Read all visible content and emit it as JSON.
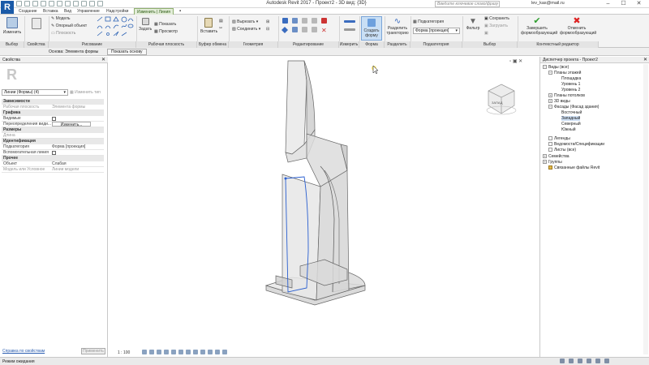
{
  "titlebar": {
    "app_logo": "R",
    "title": "Autodesk Revit 2017 - Проект2 - 3D вид: {3D}",
    "search_placeholder": "Введите ключевое слово/фразу",
    "user": "lev_kas@mail.ru"
  },
  "tabs": [
    {
      "label": "Создание"
    },
    {
      "label": "Вставка"
    },
    {
      "label": "Вид"
    },
    {
      "label": "Управление"
    },
    {
      "label": "Надстройки"
    },
    {
      "label": "Изменить | Линия"
    }
  ],
  "ribbon": {
    "modify": "Изменить",
    "draw_model": "Модель",
    "draw_ref": "Опорный объект",
    "draw_plane": "Плоскость",
    "set": "Задать",
    "show": "Показать",
    "viewer": "Просмотр",
    "paste": "Вставить",
    "cut": "Вырезать",
    "join": "Соединить",
    "create_form": "Создать форму",
    "divide_path": "Разделить траекторию",
    "subcategory": "Подкатегория",
    "subcategory_value": "Форма [проекция]",
    "filter": "Фильтр",
    "save": "Сохранить",
    "load": "Загрузить",
    "finish_form": "Завершить формообразующий",
    "cancel_form": "Отменить формообразующий",
    "panels": {
      "select": "Выбор",
      "properties": "Свойства",
      "draw": "Рисование",
      "workplane": "Рабочая плоскость",
      "clipboard": "Буфер обмена",
      "geometry": "Геометрия",
      "modify": "Редактирование",
      "measure": "Измерить",
      "form": "Форма",
      "divide": "Разделить",
      "subcategory": "Подкатегория",
      "selection": "Выбор",
      "context": "Контекстный редактор"
    }
  },
  "optbar": {
    "label": "Основа:  Элемента формы",
    "button": "Показать основу"
  },
  "properties": {
    "header": "Свойства",
    "filter": "Линии (Формы) (4)",
    "edit_type": "Изменить тип",
    "rows": [
      {
        "group": "Зависимости"
      },
      {
        "k": "Рабочая плоскость",
        "v": "Элемента формы",
        "grey": true
      },
      {
        "group": "Графика"
      },
      {
        "k": "Видимые",
        "v": "",
        "grey": false
      },
      {
        "k": "Переопределения види...",
        "v": "Изменить...",
        "grey": false
      },
      {
        "group": "Размеры"
      },
      {
        "k": "Длина",
        "v": "",
        "grey": true
      },
      {
        "group": "Идентификация"
      },
      {
        "k": "Подкатегория",
        "v": "Форма [проекция]",
        "grey": false
      },
      {
        "k": "Вспомогательная линия",
        "v": "",
        "grey": false
      },
      {
        "group": "Прочее"
      },
      {
        "k": "Объект",
        "v": "Слабая",
        "grey": false
      },
      {
        "k": "Модель или Условное",
        "v": "Линии модели",
        "grey": true
      }
    ],
    "help": "Справка по свойствам",
    "apply": "Применить"
  },
  "viewport": {
    "scale": "1 : 100",
    "cube_face": "ЗАПАД"
  },
  "browser": {
    "header": "Диспетчер проекта - Проект2",
    "items": [
      {
        "label": "Виды (все)",
        "level": 0,
        "toggle": "−"
      },
      {
        "label": "Планы этажей",
        "level": 1,
        "toggle": "−"
      },
      {
        "label": "Площадка",
        "level": 2,
        "toggle": ""
      },
      {
        "label": "Уровень 1",
        "level": 2,
        "toggle": ""
      },
      {
        "label": "Уровень 2",
        "level": 2,
        "toggle": ""
      },
      {
        "label": "Планы потолков",
        "level": 1,
        "toggle": "+"
      },
      {
        "label": "3D виды",
        "level": 1,
        "toggle": "+"
      },
      {
        "label": "Фасады (Фасад здания)",
        "level": 1,
        "toggle": "−"
      },
      {
        "label": "Восточный",
        "level": 2,
        "toggle": ""
      },
      {
        "label": "Западный",
        "level": 2,
        "toggle": "",
        "selected": true
      },
      {
        "label": "Северный",
        "level": 2,
        "toggle": ""
      },
      {
        "label": "Южный",
        "level": 2,
        "toggle": ""
      },
      {
        "label": "Легенды",
        "level": 0,
        "toggle": ""
      },
      {
        "label": "Ведомости/Спецификации",
        "level": 0,
        "toggle": ""
      },
      {
        "label": "Листы (все)",
        "level": 0,
        "toggle": ""
      },
      {
        "label": "Семейства",
        "level": 0,
        "toggle": "+"
      },
      {
        "label": "Группы",
        "level": 0,
        "toggle": "+"
      },
      {
        "label": "Связанные файлы Revit",
        "level": 0,
        "toggle": ""
      }
    ]
  },
  "status": {
    "text": "Режим ожидания"
  }
}
